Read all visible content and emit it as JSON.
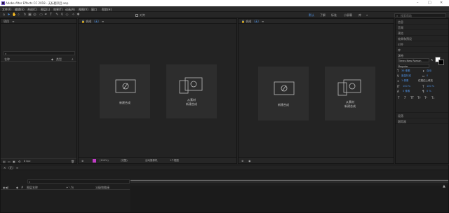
{
  "app": {
    "title": "Adobe After Effects CC 2018 - 无标题项目.aep"
  },
  "menu": [
    "文件(F)",
    "编辑(E)",
    "合成(C)",
    "图层(L)",
    "效果(T)",
    "动画(A)",
    "视图(V)",
    "窗口",
    "帮助(H)"
  ],
  "toolbar": {
    "snap_label": "对齐",
    "workspaces": [
      "默认",
      "了解",
      "标准",
      "小屏幕",
      "库"
    ],
    "search_placeholder": "搜索帮助"
  },
  "project": {
    "title": "项目",
    "search_placeholder": "⌕",
    "col_name": "名称",
    "col_type": "类型",
    "bpc": "8 bpc"
  },
  "composition_left": {
    "tab": "合成",
    "comp_name": "（无）"
  },
  "composition_right": {
    "tab": "合成",
    "comp_name": "（无）"
  },
  "tiles": {
    "new_comp": "新建合成",
    "from_footage_line1": "从素材",
    "from_footage_line2": "新建合成"
  },
  "viewer_footer_left": [
    "(100%)",
    "(完整)",
    "活动摄像机",
    "1个视图"
  ],
  "right_panels": [
    "信息",
    "音频",
    "预览",
    "效果和预设",
    "对齐",
    "库",
    "字符"
  ],
  "character": {
    "font": "Times New Roman",
    "style": "Regular",
    "size": "36 像素",
    "leading": "自动",
    "kerning": "度量标准",
    "tracking": "0",
    "stroke": "1 像素",
    "stroke_mode": "在描边上填充",
    "vscale": "100 %",
    "hscale": "100 %",
    "baseline": "0 像素",
    "tsume": "0 %",
    "styles": [
      "T",
      "T",
      "TT",
      "Tт",
      "T¹",
      "T₁"
    ]
  },
  "right_bottom": [
    "段落",
    "跟踪器"
  ],
  "timeline": {
    "tab": "（无）",
    "search_placeholder": "⌕",
    "col_layer": "图层名称",
    "col_parent": "父级和链接"
  },
  "colors": {
    "accent": "#4d8fe0",
    "tile": "#2d2d2d",
    "panel": "#232323",
    "magenta": "#c13cc6"
  }
}
